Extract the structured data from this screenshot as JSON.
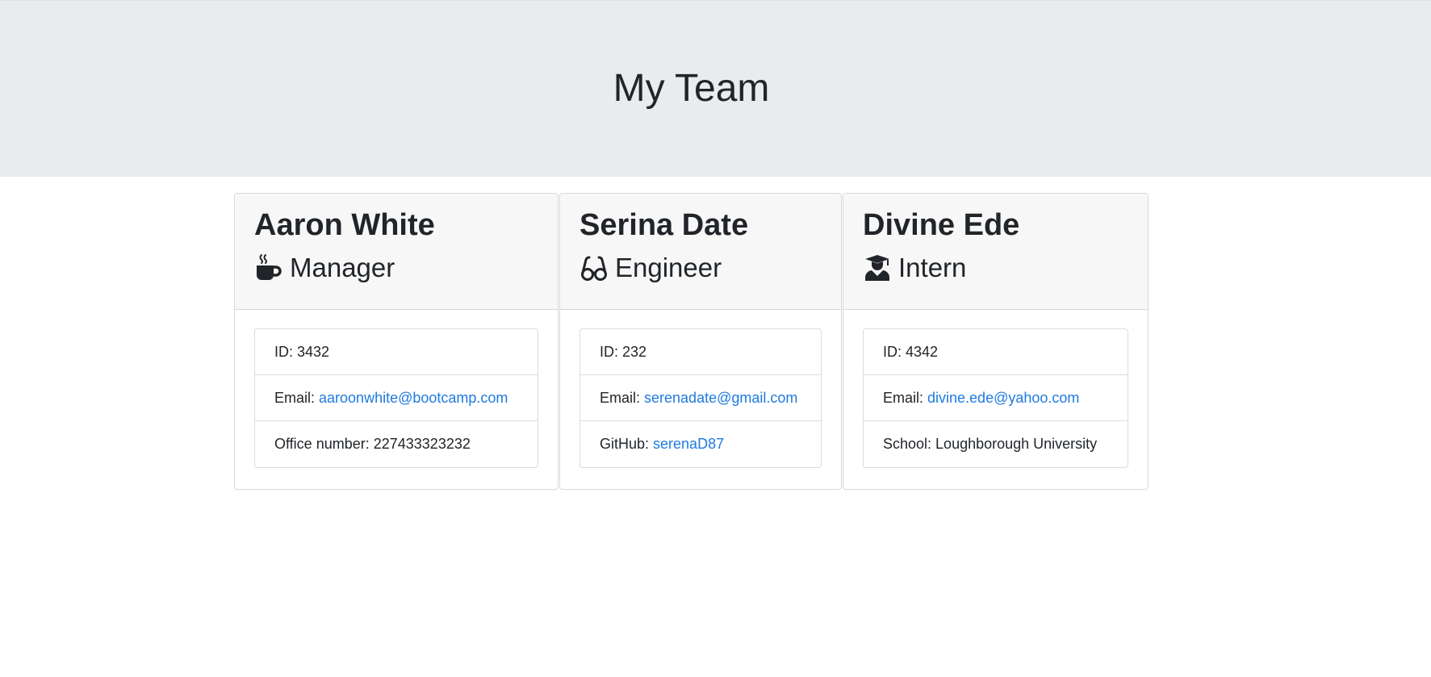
{
  "header": {
    "title": "My Team"
  },
  "team": [
    {
      "name": "Aaron White",
      "role": "Manager",
      "role_icon": "mug-hot-icon",
      "id_label": "ID: 3432",
      "email_label": "Email:",
      "email": "aaroonwhite@bootcamp.com",
      "extra_label": "Office number:",
      "extra_value": "227433323232"
    },
    {
      "name": "Serina Date",
      "role": "Engineer",
      "role_icon": "glasses-icon",
      "id_label": "ID: 232",
      "email_label": "Email:",
      "email": "serenadate@gmail.com",
      "extra_label": "GitHub:",
      "extra_value": "serenaD87"
    },
    {
      "name": "Divine Ede",
      "role": "Intern",
      "role_icon": "user-graduate-icon",
      "id_label": "ID: 4342",
      "email_label": "Email:",
      "email": "divine.ede@yahoo.com",
      "extra_label": "School:",
      "extra_value": "Loughborough University"
    }
  ],
  "colors": {
    "jumbotron_bg": "#e9ecef",
    "link": "#1f7ae0",
    "card_header_bg": "#f7f7f7",
    "text": "#212529"
  }
}
